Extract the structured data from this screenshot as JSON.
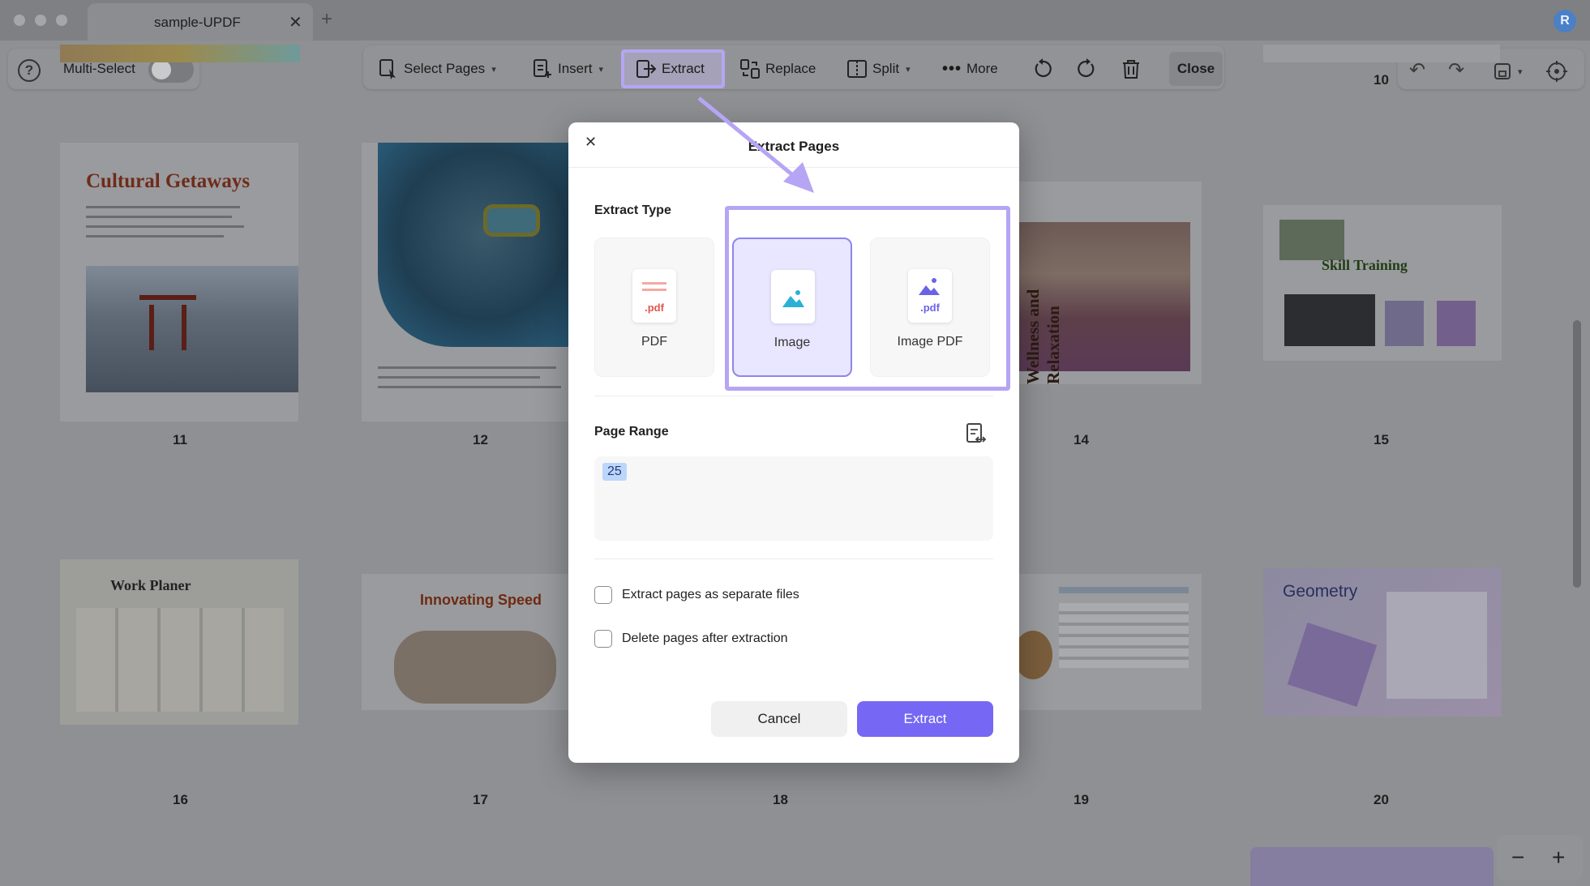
{
  "tab": {
    "title": "sample-UPDF",
    "close": "✕",
    "new": "+"
  },
  "account": {
    "initial": "R"
  },
  "toolbar": {
    "multi_select": "Multi-Select",
    "select_pages": "Select Pages",
    "insert": "Insert",
    "extract": "Extract",
    "replace": "Replace",
    "split": "Split",
    "more": "More",
    "close": "Close"
  },
  "pages": {
    "top_right_num": "10",
    "labels": [
      "11",
      "12",
      "14",
      "15",
      "16",
      "17",
      "18",
      "19",
      "20"
    ],
    "thumb_titles": {
      "cultural": "Cultural Getaways",
      "work": "Work Planer",
      "innovating": "Innovating Speed",
      "geometry": "Geometry",
      "skill": "Skill Training",
      "wellness": "Wellness and Relaxation"
    }
  },
  "dialog": {
    "title": "Extract Pages",
    "extract_type_label": "Extract Type",
    "types": [
      {
        "label": "PDF",
        "ext": ".pdf",
        "selected": false
      },
      {
        "label": "Image",
        "ext": "",
        "selected": true
      },
      {
        "label": "Image PDF",
        "ext": ".pdf",
        "selected": false
      }
    ],
    "page_range_label": "Page Range",
    "page_range_value": "25",
    "option_separate": "Extract pages as separate files",
    "option_delete": "Delete pages after extraction",
    "cancel": "Cancel",
    "extract": "Extract"
  },
  "colors": {
    "accent": "#7668f4",
    "highlight": "#b6a5f4",
    "selected_card": "#e9e6ff"
  },
  "icons": [
    "help-icon",
    "select-pages-icon",
    "insert-icon",
    "extract-icon",
    "replace-icon",
    "split-icon",
    "more-icon",
    "rotate-left-icon",
    "rotate-right-icon",
    "trash-icon",
    "undo-icon",
    "redo-icon",
    "save-icon",
    "share-icon",
    "page-range-icon",
    "zoom-out-icon",
    "zoom-in-icon"
  ]
}
